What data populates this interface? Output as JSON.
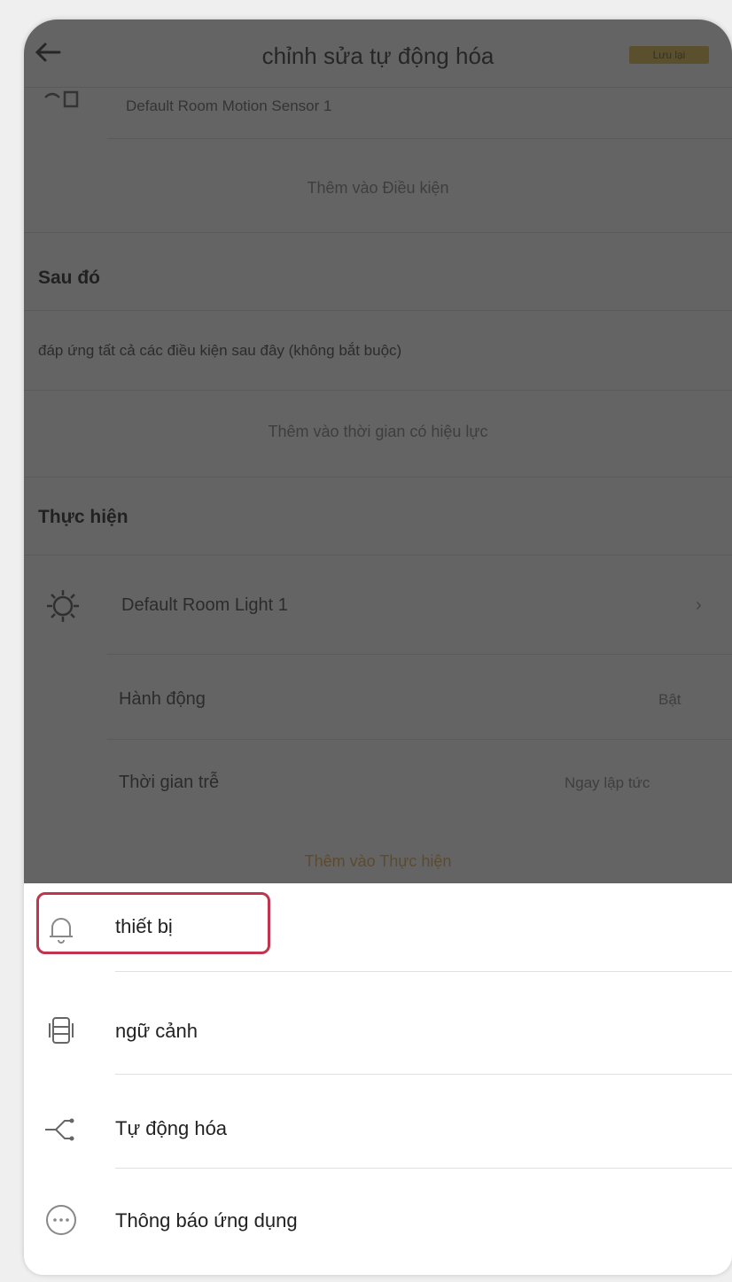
{
  "header": {
    "title": "chỉnh sửa tự động hóa",
    "save_label": "Lưu lại"
  },
  "background": {
    "condition_device": "Default Room Motion Sensor 1",
    "add_condition": "Thêm vào Điều kiện",
    "then_title": "Sau đó",
    "then_desc": "đáp ứng tất cả các điều kiện sau đây (không bắt buộc)",
    "add_effective_time": "Thêm vào thời gian có hiệu lực",
    "action_title": "Thực hiện",
    "action_device": "Default Room Light 1",
    "action_label": "Hành động",
    "action_value": "Bật",
    "delay_label": "Thời gian trễ",
    "delay_value": "Ngay lập tức",
    "add_action": "Thêm vào Thực hiện"
  },
  "sheet": {
    "options": [
      {
        "label": "thiết bị",
        "icon": "bell-icon"
      },
      {
        "label": "ngữ cảnh",
        "icon": "scene-icon"
      },
      {
        "label": "Tự động hóa",
        "icon": "automation-icon"
      },
      {
        "label": "Thông báo ứng dụng",
        "icon": "chat-icon"
      }
    ]
  },
  "colors": {
    "accent": "#e6a23c",
    "highlight": "#c0344d",
    "overlay": "#3c3c3c"
  }
}
